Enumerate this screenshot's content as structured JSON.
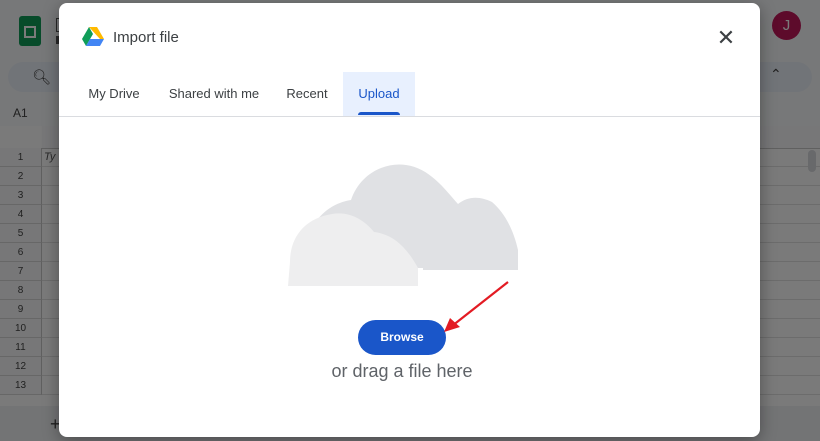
{
  "background": {
    "avatar_initial": "J",
    "namebox": "A1",
    "row_numbers": [
      "1",
      "2",
      "3",
      "4",
      "5",
      "6",
      "7",
      "8",
      "9",
      "10",
      "11",
      "12",
      "13"
    ],
    "cell_a1_text": "Ty"
  },
  "dialog": {
    "title": "Import file",
    "tabs": [
      {
        "label": "My Drive",
        "active": false
      },
      {
        "label": "Shared with me",
        "active": false
      },
      {
        "label": "Recent",
        "active": false
      },
      {
        "label": "Upload",
        "active": true
      }
    ],
    "upload": {
      "browse_label": "Browse",
      "drag_text": "or drag a file here"
    }
  },
  "colors": {
    "accent": "#1a56c9",
    "active_tab_bg": "#e8f0fe",
    "annotation_arrow": "#e31b23"
  },
  "icons": {
    "close": "close-icon",
    "drive": "google-drive-logo",
    "cloud": "cloud-upload-illustration"
  }
}
